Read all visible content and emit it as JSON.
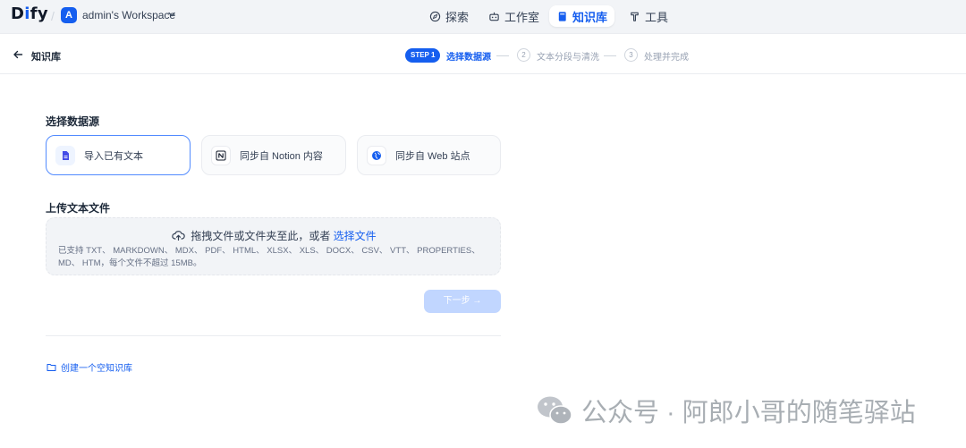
{
  "header": {
    "logo_text": "Dify",
    "workspace_avatar": "A",
    "workspace_name": "admin's Workspace",
    "nav": [
      {
        "label": "探索",
        "icon": "compass-icon",
        "active": false
      },
      {
        "label": "工作室",
        "icon": "robot-icon",
        "active": false
      },
      {
        "label": "知识库",
        "icon": "book-icon",
        "active": true
      },
      {
        "label": "工具",
        "icon": "tools-icon",
        "active": false
      }
    ]
  },
  "subheader": {
    "back_label": "知识库",
    "steps": {
      "step1_pill": "STEP 1",
      "step1_label": "选择数据源",
      "step2_num": "2",
      "step2_label": "文本分段与清洗",
      "step3_num": "3",
      "step3_label": "处理并完成"
    }
  },
  "datasource": {
    "title": "选择数据源",
    "options": [
      {
        "label": "导入已有文本",
        "icon": "file-icon",
        "selected": true
      },
      {
        "label": "同步自 Notion 内容",
        "icon": "notion-icon",
        "selected": false
      },
      {
        "label": "同步自 Web 站点",
        "icon": "globe-icon",
        "selected": false
      }
    ]
  },
  "upload": {
    "title": "上传文本文件",
    "drag_text": "拖拽文件或文件夹至此，或者",
    "select_link": "选择文件",
    "supported_line1": "已支持 TXT、 MARKDOWN、 MDX、 PDF、 HTML、 XLSX、 XLS、 DOCX、 CSV、 VTT、 PROPERTIES、",
    "supported_line2": "MD、 HTM，每个文件不超过 15MB。"
  },
  "next_button": "下一步 →",
  "create_empty": "创建一个空知识库",
  "watermark": "公众号 · 阿郎小哥的随笔驿站",
  "colors": {
    "accent": "#155eef",
    "nav_bg": "#f2f4f7",
    "disabled_button": "#b2ccff"
  }
}
